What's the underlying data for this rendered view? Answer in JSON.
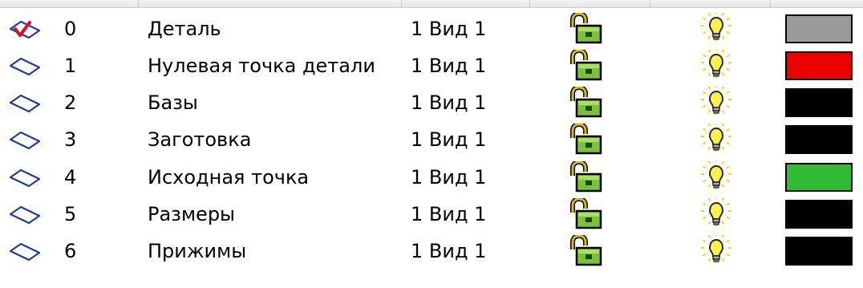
{
  "layers": [
    {
      "num": "0",
      "name": "Деталь",
      "view": "1 Вид 1",
      "active": true,
      "color": "#9a9a9a"
    },
    {
      "num": "1",
      "name": "Нулевая точка детали",
      "view": "1 Вид 1",
      "active": false,
      "color": "#ee0000"
    },
    {
      "num": "2",
      "name": "Базы",
      "view": "1 Вид 1",
      "active": false,
      "color": "#000000"
    },
    {
      "num": "3",
      "name": "Заготовка",
      "view": "1 Вид 1",
      "active": false,
      "color": "#000000"
    },
    {
      "num": "4",
      "name": "Исходная точка",
      "view": "1 Вид 1",
      "active": false,
      "color": "#33bb33"
    },
    {
      "num": "5",
      "name": "Размеры",
      "view": "1 Вид 1",
      "active": false,
      "color": "#000000"
    },
    {
      "num": "6",
      "name": "Прижимы",
      "view": "1 Вид 1",
      "active": false,
      "color": "#000000"
    }
  ],
  "icons": {
    "layer": "layer-plane-icon",
    "active": "checkmark-icon",
    "lock": "unlocked-padlock-icon",
    "visibility": "lightbulb-icon"
  }
}
